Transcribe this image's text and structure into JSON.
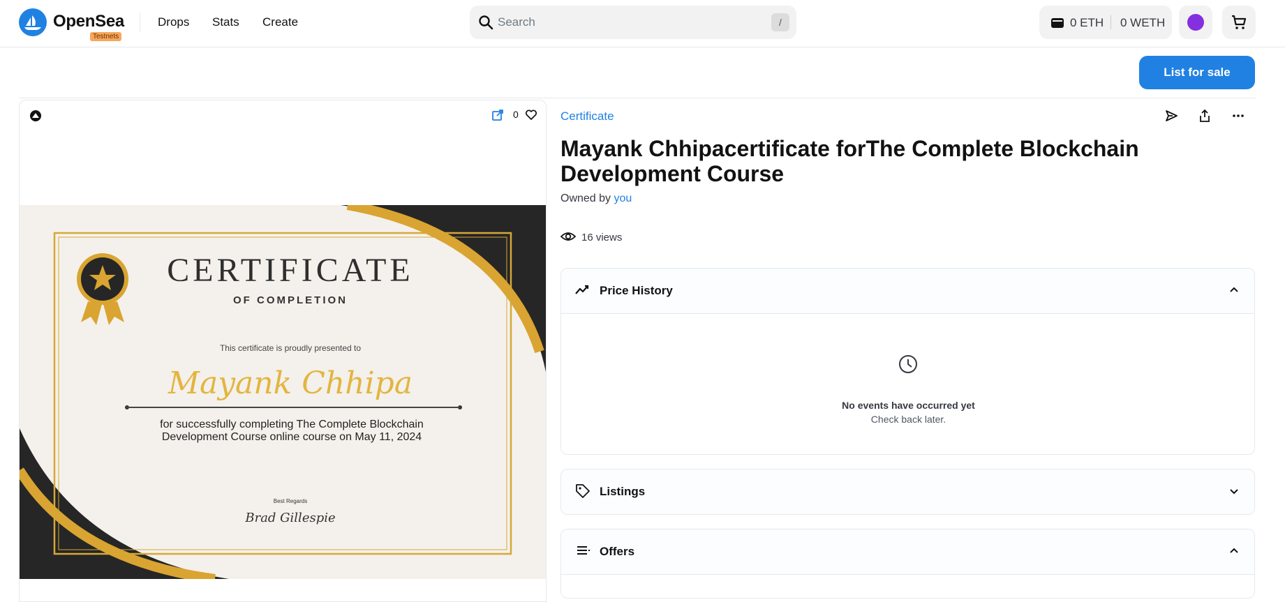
{
  "header": {
    "brand": "OpenSea",
    "network_badge": "Testnets",
    "nav": [
      "Drops",
      "Stats",
      "Create"
    ],
    "search_placeholder": "Search",
    "search_shortcut": "/",
    "eth_balance": "0 ETH",
    "weth_balance": "0 WETH"
  },
  "toolbar": {
    "list_for_sale": "List for sale"
  },
  "media": {
    "favorite_count": "0"
  },
  "certificate": {
    "title": "CERTIFICATE",
    "subtitle": "OF COMPLETION",
    "presented": "This certificate is proudly presented to",
    "name": "Mayank Chhipa",
    "description": "for successfully completing The Complete Blockchain Development Course online course on May 11, 2024",
    "regards": "Best Regards",
    "signature": "Brad Gillespie"
  },
  "item": {
    "collection": "Certificate",
    "title": "Mayank Chhipacertificate forThe Complete Blockchain Development Course",
    "owned_by_label": "Owned by",
    "owner": "you",
    "views": "16 views"
  },
  "panels": {
    "price_history": {
      "title": "Price History",
      "empty_title": "No events have occurred yet",
      "empty_sub": "Check back later."
    },
    "listings": {
      "title": "Listings"
    },
    "offers": {
      "title": "Offers"
    }
  },
  "colors": {
    "accent": "#2081e2",
    "testnet_badge": "#f6a75b",
    "avatar": "#8430e0",
    "cert_gold": "#e3b540"
  }
}
